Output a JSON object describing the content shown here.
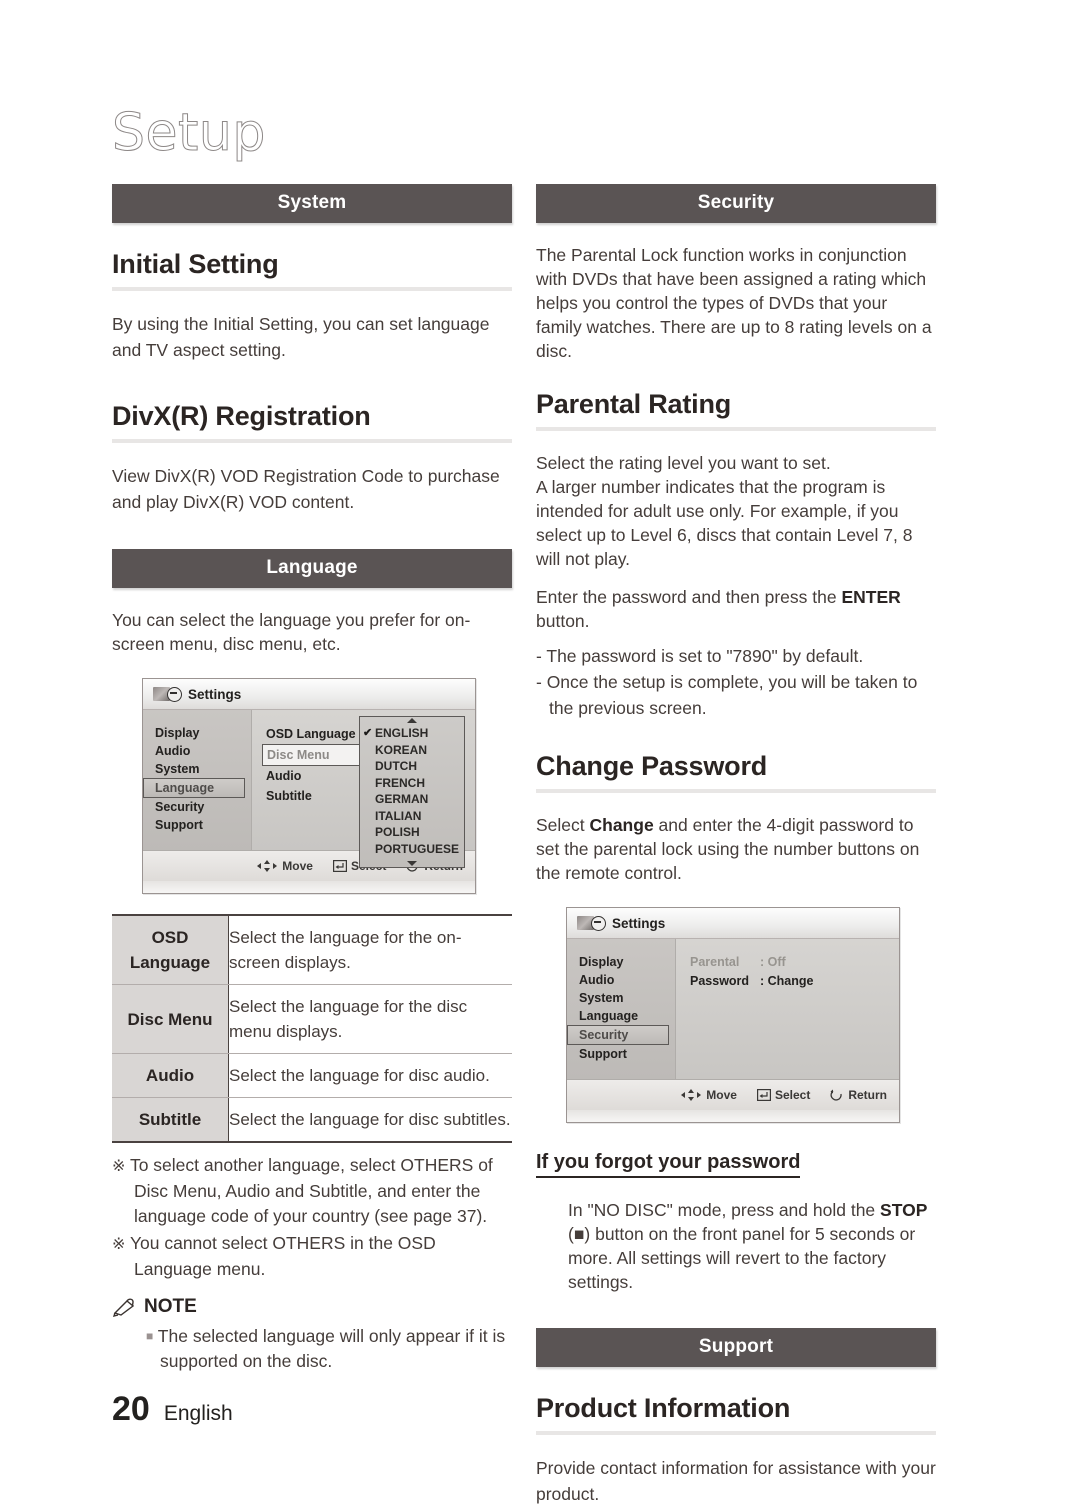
{
  "page": {
    "title": "Setup",
    "footer_page_number": "20",
    "footer_language": "English"
  },
  "left_column": {
    "section_system": {
      "bar_label": "System"
    },
    "initial_setting": {
      "heading": "Initial Setting",
      "body": "By using the Initial Setting, you can set language and TV aspect setting."
    },
    "divx_registration": {
      "heading": "DivX(R) Registration",
      "body": "View DivX(R) VOD Registration Code to purchase and play DivX(R) VOD content."
    },
    "section_language": {
      "bar_label": "Language"
    },
    "language_intro": "You can select the language you prefer for on-screen menu, disc menu, etc.",
    "language_screenshot": {
      "title": "Settings",
      "menu_items": [
        "Display",
        "Audio",
        "System",
        "Language",
        "Security",
        "Support"
      ],
      "selected_menu_item": "Language",
      "submenu_items": [
        "OSD Language",
        "Disc Menu",
        "Audio",
        "Subtitle"
      ],
      "highlighted_submenu_item": "Disc Menu",
      "dropdown_options": [
        "ENGLISH",
        "KOREAN",
        "DUTCH",
        "FRENCH",
        "GERMAN",
        "ITALIAN",
        "POLISH",
        "PORTUGUESE"
      ],
      "checked_option": "ENGLISH",
      "footer_hints": [
        "Move",
        "Select",
        "Return"
      ]
    },
    "language_table": {
      "rows": [
        {
          "key": "OSD Language",
          "value": "Select the language for the on-screen displays."
        },
        {
          "key": "Disc Menu",
          "value": "Select the language for the disc menu displays."
        },
        {
          "key": "Audio",
          "value": "Select the language for disc audio."
        },
        {
          "key": "Subtitle",
          "value": "Select the language for disc subtitles."
        }
      ]
    },
    "asterisk_notes": [
      "To select another language, select OTHERS of Disc Menu, Audio and Subtitle, and enter the language code of your country (see page 37).",
      "You cannot select OTHERS in the OSD Language menu."
    ],
    "note_block": {
      "heading": "NOTE",
      "bullets": [
        "The selected language will only appear if it is supported on the disc."
      ]
    }
  },
  "right_column": {
    "section_security": {
      "bar_label": "Security"
    },
    "security_intro": "The Parental Lock function works in conjunction with DVDs that have been assigned a rating which helps you control the types of DVDs that your family watches. There are up to 8 rating levels on a disc.",
    "parental_rating": {
      "heading": "Parental Rating",
      "paragraph_1": "Select the rating level you want to set.",
      "paragraph_2": "A larger number indicates that the program is intended for adult use only. For example, if you select up to Level 6, discs that contain Level 7, 8 will not play.",
      "paragraph_3_a": "Enter the password and then press the ",
      "paragraph_3_bold": "ENTER",
      "paragraph_3_b": " button.",
      "dashes": [
        "- The password is set to \"7890\" by default.",
        "- Once the setup is complete, you will be taken to the previous screen."
      ]
    },
    "change_password": {
      "heading": "Change Password",
      "body_a": "Select ",
      "body_bold": "Change",
      "body_b": " and enter the 4-digit password to set the parental lock using the number buttons on the remote control."
    },
    "security_screenshot": {
      "title": "Settings",
      "menu_items": [
        "Display",
        "Audio",
        "System",
        "Language",
        "Security",
        "Support"
      ],
      "selected_menu_item": "Security",
      "settings": [
        {
          "key": "Parental",
          "value": ": Off",
          "dimmed": true
        },
        {
          "key": "Password",
          "value": ": Change",
          "dimmed": false
        }
      ],
      "footer_hints": [
        "Move",
        "Select",
        "Return"
      ]
    },
    "forgot_password": {
      "heading": "If you forgot your password",
      "body_a": "In \"NO DISC\" mode, press and hold the ",
      "body_bold": "STOP",
      "body_b": " (■) button on the front panel for 5 seconds or more. All settings will revert to the factory settings."
    },
    "section_support": {
      "bar_label": "Support"
    },
    "product_information": {
      "heading": "Product Information",
      "body": "Provide contact information for assistance with your product."
    }
  },
  "colors": {
    "section_bar_bg": "#5a5454",
    "heading_rule": "#e8e6e5",
    "table_key_bg": "#d9d6d4",
    "text": "#453d3a"
  }
}
